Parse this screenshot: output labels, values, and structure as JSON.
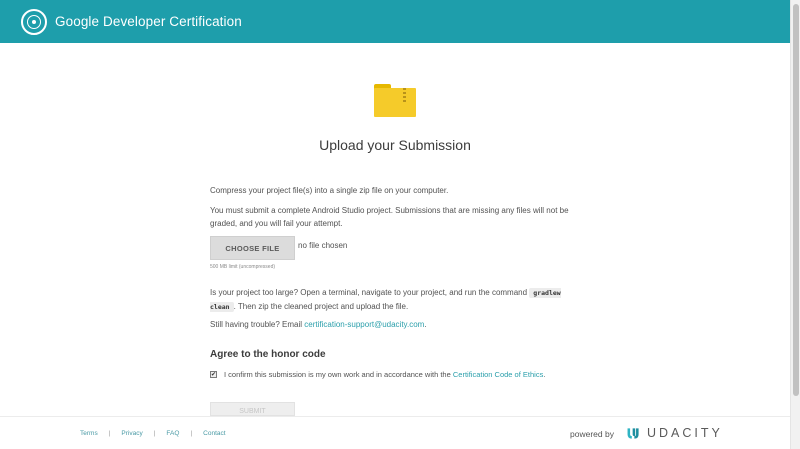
{
  "header": {
    "title": "Google Developer Certification"
  },
  "main": {
    "title": "Upload your Submission",
    "instruction": "Compress your project file(s) into a single zip file on your computer.",
    "requirement": "You must submit a complete Android Studio project. Submissions that are missing any files will not be graded, and you will fail your attempt.",
    "choose_file_label": "CHOOSE FILE",
    "file_status": "no file chosen",
    "size_limit": "500 MB limit (uncompressed)",
    "too_large_prefix": "Is your project too large? Open a terminal, navigate to your project, and run the command",
    "command": "gradlew clean",
    "too_large_suffix": ". Then zip the cleaned project and upload the file.",
    "trouble_prefix": "Still having trouble? Email",
    "support_email": "certification-support@udacity.com",
    "trouble_suffix": ".",
    "honor_title": "Agree to the honor code",
    "confirm_prefix": "I confirm this submission is my own work and in accordance with the",
    "ethics_link": "Certification Code of Ethics",
    "confirm_suffix": ".",
    "checkbox_mark": "✔",
    "submit_label": "SUBMIT"
  },
  "footer": {
    "links": [
      "Terms",
      "Privacy",
      "FAQ",
      "Contact"
    ],
    "separator": "|",
    "powered_by": "powered by",
    "brand": "UDACITY"
  },
  "colors": {
    "header_bg": "#1e9eab",
    "link": "#2b9fab",
    "folder": "#f5cb2a"
  },
  "icons": {
    "logo": "certification-badge-icon",
    "folder": "zip-folder-icon",
    "brand": "udacity-logo-icon"
  }
}
